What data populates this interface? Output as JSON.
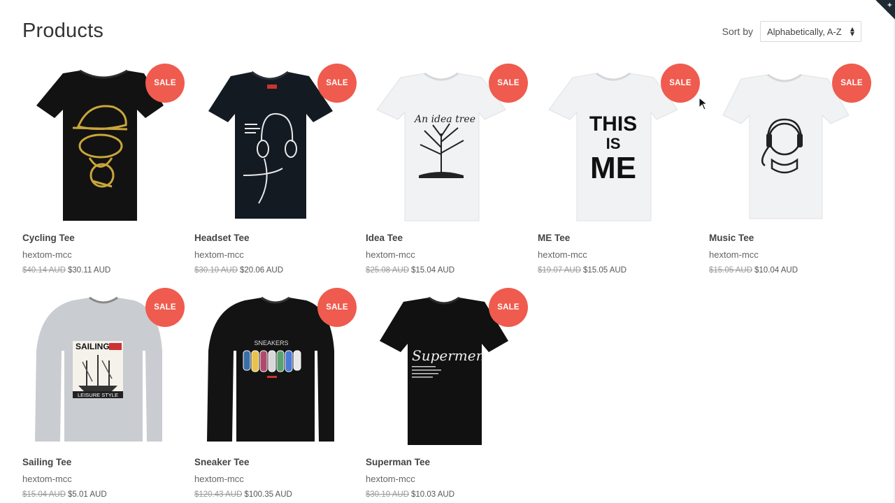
{
  "page": {
    "title": "Products"
  },
  "sort": {
    "label": "Sort by",
    "selected": "Alphabetically, A-Z"
  },
  "products": [
    {
      "name": "Cycling Tee",
      "vendor": "hextom-mcc",
      "old_price": "$40.14 AUD",
      "price": "$30.11 AUD",
      "badge": "SALE"
    },
    {
      "name": "Headset Tee",
      "vendor": "hextom-mcc",
      "old_price": "$30.10 AUD",
      "price": "$20.06 AUD",
      "badge": "SALE"
    },
    {
      "name": "Idea Tee",
      "vendor": "hextom-mcc",
      "old_price": "$25.08 AUD",
      "price": "$15.04 AUD",
      "badge": "SALE",
      "print_text": "An idea tree"
    },
    {
      "name": "ME Tee",
      "vendor": "hextom-mcc",
      "old_price": "$19.07 AUD",
      "price": "$15.05 AUD",
      "badge": "SALE",
      "print_text": [
        "THIS",
        "IS",
        "ME"
      ]
    },
    {
      "name": "Music Tee",
      "vendor": "hextom-mcc",
      "old_price": "$15.05 AUD",
      "price": "$10.04 AUD",
      "badge": "SALE"
    },
    {
      "name": "Sailing Tee",
      "vendor": "hextom-mcc",
      "old_price": "$15.04 AUD",
      "price": "$5.01 AUD",
      "badge": "SALE",
      "print_text": [
        "SAILING",
        "LEISURE STYLE"
      ]
    },
    {
      "name": "Sneaker Tee",
      "vendor": "hextom-mcc",
      "old_price": "$120.43 AUD",
      "price": "$100.35 AUD",
      "badge": "SALE",
      "print_text": "SNEAKERS"
    },
    {
      "name": "Superman Tee",
      "vendor": "hextom-mcc",
      "old_price": "$30.10 AUD",
      "price": "$10.03 AUD",
      "badge": "SALE",
      "print_text": "Supermen"
    }
  ],
  "colors": {
    "sale": "#ef5b4e",
    "black_tee": "#121212",
    "white_tee": "#f3f4f6",
    "grey_tee": "#c9ccd0"
  }
}
